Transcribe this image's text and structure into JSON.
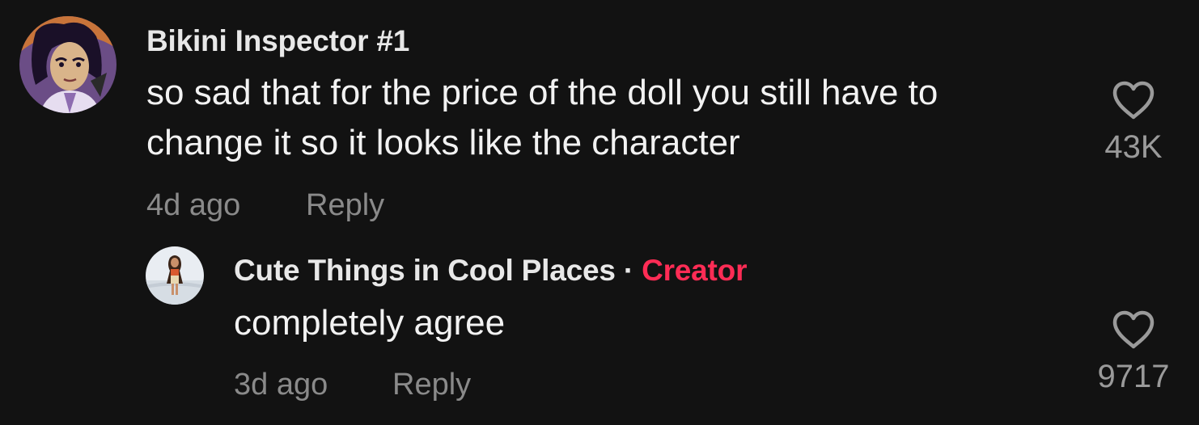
{
  "comment": {
    "author": "Bikini Inspector #1",
    "text_line1": "so sad that for the price of the doll you still have to",
    "text_line2": "change it so it looks like the character",
    "time": "4d ago",
    "reply_label": "Reply",
    "likes": "43K",
    "avatar_icon": "cartoon-avatar"
  },
  "reply": {
    "author": "Cute Things in Cool Places",
    "separator": "·",
    "badge": "Creator",
    "text": "completely agree",
    "time": "3d ago",
    "reply_label": "Reply",
    "likes": "9717",
    "avatar_icon": "photo-avatar"
  },
  "colors": {
    "background": "#121212",
    "creator_badge": "#fe2c55",
    "muted_text": "#8a8a8a"
  }
}
